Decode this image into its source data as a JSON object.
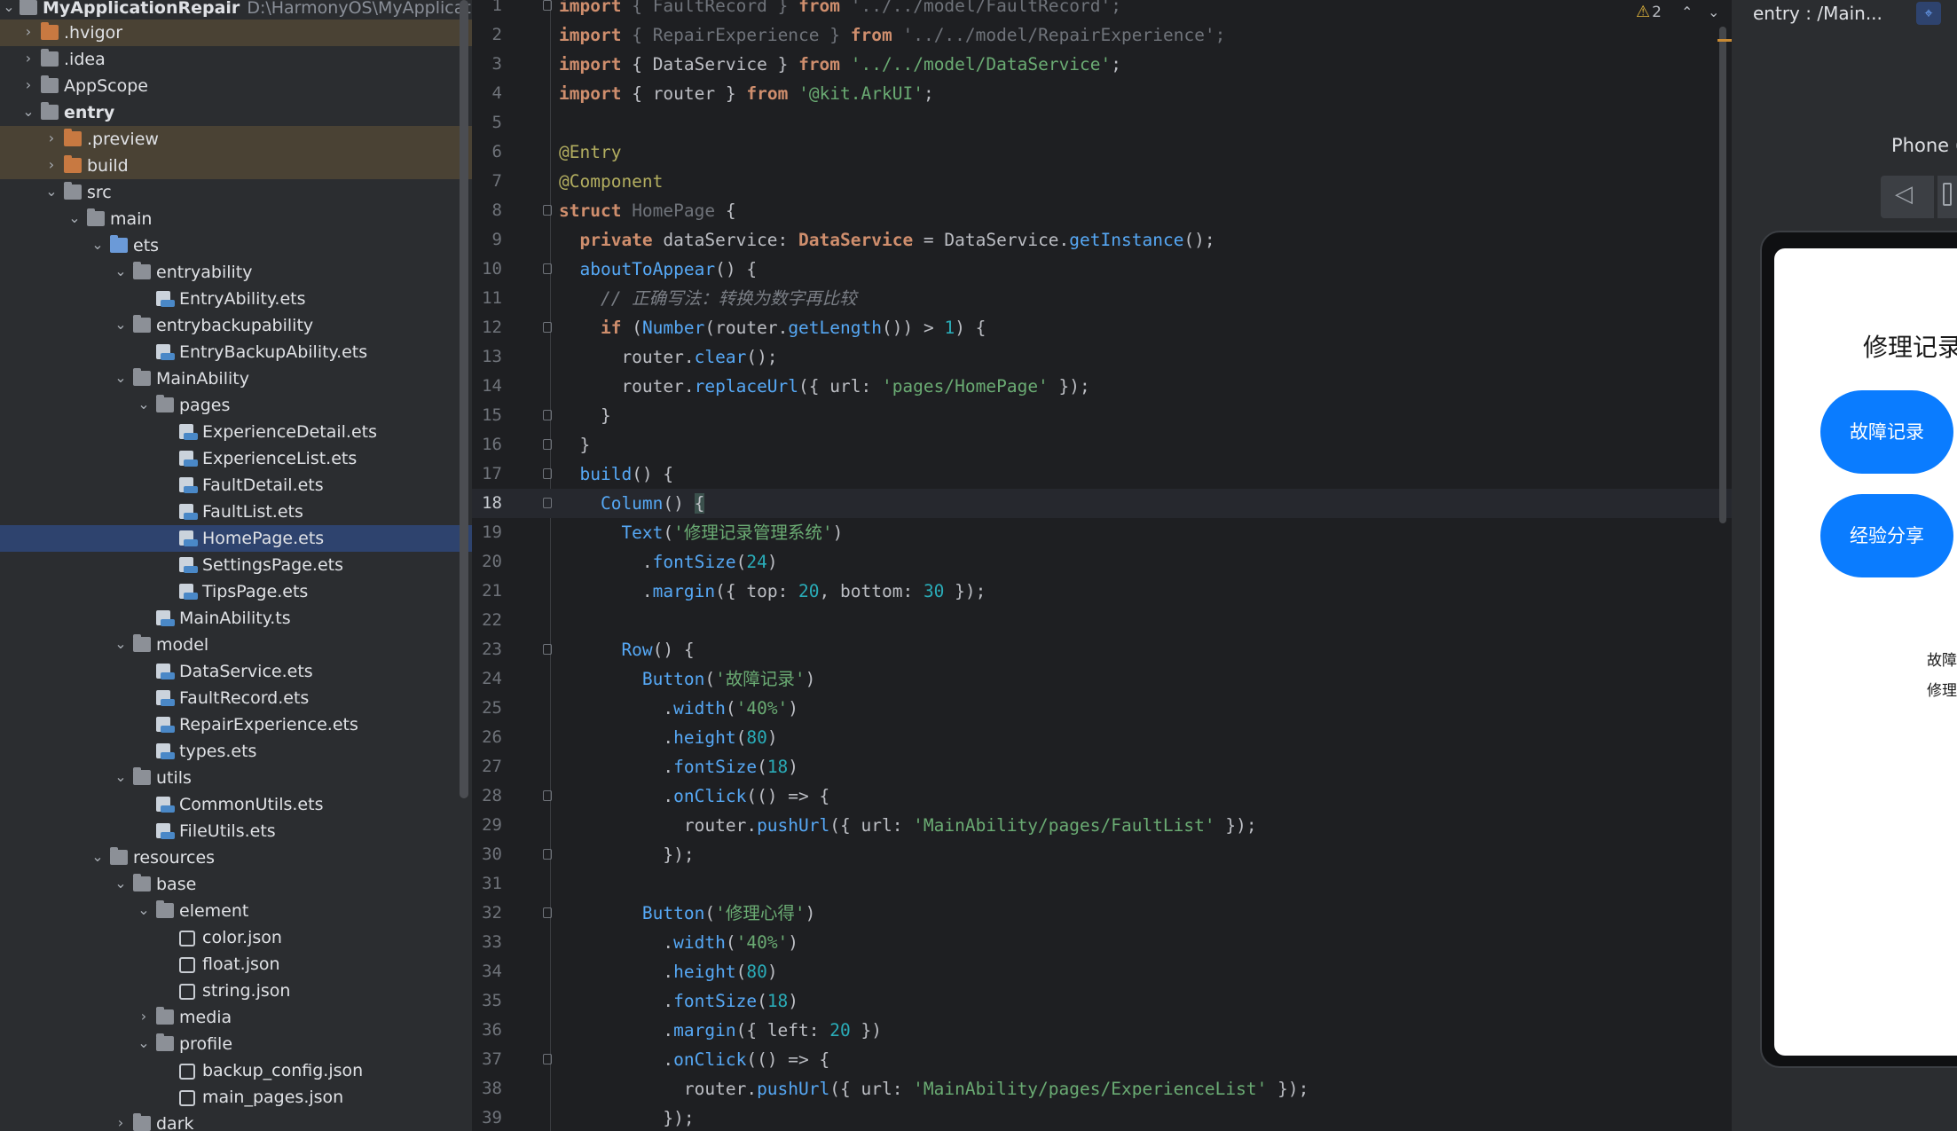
{
  "project": {
    "root": {
      "name": "MyApplicationRepair",
      "path": "D:\\HarmonyOS\\MyApplicationRe"
    },
    "items": [
      {
        "label": ".hvigor",
        "depth": 1,
        "kind": "folder-orange",
        "arrow": "›",
        "state": "excluded"
      },
      {
        "label": ".idea",
        "depth": 1,
        "kind": "folder",
        "arrow": "›",
        "state": ""
      },
      {
        "label": "AppScope",
        "depth": 1,
        "kind": "folder",
        "arrow": "›",
        "state": ""
      },
      {
        "label": "entry",
        "depth": 1,
        "kind": "folder",
        "arrow": "⌄",
        "state": "",
        "bold": true
      },
      {
        "label": ".preview",
        "depth": 2,
        "kind": "folder-orange",
        "arrow": "›",
        "state": "excluded"
      },
      {
        "label": "build",
        "depth": 2,
        "kind": "folder-orange",
        "arrow": "›",
        "state": "excluded"
      },
      {
        "label": "src",
        "depth": 2,
        "kind": "folder",
        "arrow": "⌄",
        "state": ""
      },
      {
        "label": "main",
        "depth": 3,
        "kind": "folder",
        "arrow": "⌄",
        "state": ""
      },
      {
        "label": "ets",
        "depth": 4,
        "kind": "folder-blue",
        "arrow": "⌄",
        "state": ""
      },
      {
        "label": "entryability",
        "depth": 5,
        "kind": "folder",
        "arrow": "⌄",
        "state": ""
      },
      {
        "label": "EntryAbility.ets",
        "depth": 6,
        "kind": "file",
        "arrow": "",
        "state": ""
      },
      {
        "label": "entrybackupability",
        "depth": 5,
        "kind": "folder",
        "arrow": "⌄",
        "state": ""
      },
      {
        "label": "EntryBackupAbility.ets",
        "depth": 6,
        "kind": "file",
        "arrow": "",
        "state": ""
      },
      {
        "label": "MainAbility",
        "depth": 5,
        "kind": "folder",
        "arrow": "⌄",
        "state": ""
      },
      {
        "label": "pages",
        "depth": 6,
        "kind": "folder",
        "arrow": "⌄",
        "state": ""
      },
      {
        "label": "ExperienceDetail.ets",
        "depth": 7,
        "kind": "file",
        "arrow": "",
        "state": ""
      },
      {
        "label": "ExperienceList.ets",
        "depth": 7,
        "kind": "file",
        "arrow": "",
        "state": ""
      },
      {
        "label": "FaultDetail.ets",
        "depth": 7,
        "kind": "file",
        "arrow": "",
        "state": ""
      },
      {
        "label": "FaultList.ets",
        "depth": 7,
        "kind": "file",
        "arrow": "",
        "state": ""
      },
      {
        "label": "HomePage.ets",
        "depth": 7,
        "kind": "file",
        "arrow": "",
        "state": "selected"
      },
      {
        "label": "SettingsPage.ets",
        "depth": 7,
        "kind": "file",
        "arrow": "",
        "state": ""
      },
      {
        "label": "TipsPage.ets",
        "depth": 7,
        "kind": "file",
        "arrow": "",
        "state": ""
      },
      {
        "label": "MainAbility.ts",
        "depth": 6,
        "kind": "file",
        "arrow": "",
        "state": ""
      },
      {
        "label": "model",
        "depth": 5,
        "kind": "folder",
        "arrow": "⌄",
        "state": ""
      },
      {
        "label": "DataService.ets",
        "depth": 6,
        "kind": "file",
        "arrow": "",
        "state": ""
      },
      {
        "label": "FaultRecord.ets",
        "depth": 6,
        "kind": "file",
        "arrow": "",
        "state": ""
      },
      {
        "label": "RepairExperience.ets",
        "depth": 6,
        "kind": "file",
        "arrow": "",
        "state": ""
      },
      {
        "label": "types.ets",
        "depth": 6,
        "kind": "file",
        "arrow": "",
        "state": ""
      },
      {
        "label": "utils",
        "depth": 5,
        "kind": "folder",
        "arrow": "⌄",
        "state": ""
      },
      {
        "label": "CommonUtils.ets",
        "depth": 6,
        "kind": "file",
        "arrow": "",
        "state": ""
      },
      {
        "label": "FileUtils.ets",
        "depth": 6,
        "kind": "file",
        "arrow": "",
        "state": ""
      },
      {
        "label": "resources",
        "depth": 4,
        "kind": "folder",
        "arrow": "⌄",
        "state": ""
      },
      {
        "label": "base",
        "depth": 5,
        "kind": "folder",
        "arrow": "⌄",
        "state": ""
      },
      {
        "label": "element",
        "depth": 6,
        "kind": "folder",
        "arrow": "⌄",
        "state": ""
      },
      {
        "label": "color.json",
        "depth": 7,
        "kind": "json",
        "arrow": "",
        "state": ""
      },
      {
        "label": "float.json",
        "depth": 7,
        "kind": "json",
        "arrow": "",
        "state": ""
      },
      {
        "label": "string.json",
        "depth": 7,
        "kind": "json",
        "arrow": "",
        "state": ""
      },
      {
        "label": "media",
        "depth": 6,
        "kind": "folder",
        "arrow": "›",
        "state": ""
      },
      {
        "label": "profile",
        "depth": 6,
        "kind": "folder",
        "arrow": "⌄",
        "state": ""
      },
      {
        "label": "backup_config.json",
        "depth": 7,
        "kind": "json",
        "arrow": "",
        "state": ""
      },
      {
        "label": "main_pages.json",
        "depth": 7,
        "kind": "json",
        "arrow": "",
        "state": ""
      },
      {
        "label": "dark",
        "depth": 5,
        "kind": "folder",
        "arrow": "›",
        "state": ""
      }
    ]
  },
  "editor": {
    "current_line": 18,
    "warnings": {
      "icon": "⚠",
      "count": "2"
    },
    "nav_up": "⌃",
    "nav_down": "⌄",
    "lines": [
      [
        {
          "t": "import",
          "c": "kw"
        },
        {
          "t": " { ",
          "c": "dim"
        },
        {
          "t": "FaultRecord",
          "c": "dim"
        },
        {
          "t": " } ",
          "c": "dim"
        },
        {
          "t": "from",
          "c": "kw"
        },
        {
          "t": " '../../model/FaultRecord';",
          "c": "dim"
        }
      ],
      [
        {
          "t": "import",
          "c": "kw"
        },
        {
          "t": " { ",
          "c": "dim"
        },
        {
          "t": "RepairExperience",
          "c": "dim"
        },
        {
          "t": " } ",
          "c": "dim"
        },
        {
          "t": "from",
          "c": "kw"
        },
        {
          "t": " '../../model/RepairExperience';",
          "c": "dim"
        }
      ],
      [
        {
          "t": "import",
          "c": "kw"
        },
        {
          "t": " { ",
          "c": ""
        },
        {
          "t": "DataService",
          "c": ""
        },
        {
          "t": " } ",
          "c": ""
        },
        {
          "t": "from",
          "c": "kw"
        },
        {
          "t": " '../../model/DataService'",
          "c": "str"
        },
        {
          "t": ";",
          "c": ""
        }
      ],
      [
        {
          "t": "import",
          "c": "kw"
        },
        {
          "t": " { ",
          "c": ""
        },
        {
          "t": "router",
          "c": ""
        },
        {
          "t": " } ",
          "c": ""
        },
        {
          "t": "from",
          "c": "kw"
        },
        {
          "t": " '@kit.ArkUI'",
          "c": "str"
        },
        {
          "t": ";",
          "c": ""
        }
      ],
      [],
      [
        {
          "t": "@Entry",
          "c": "ann"
        }
      ],
      [
        {
          "t": "@Component",
          "c": "ann"
        }
      ],
      [
        {
          "t": "struct",
          "c": "kw"
        },
        {
          "t": " HomePage ",
          "c": "dim"
        },
        {
          "t": "{",
          "c": ""
        }
      ],
      [
        {
          "t": "  private",
          "c": "kw"
        },
        {
          "t": " dataService: ",
          "c": ""
        },
        {
          "t": "DataService",
          "c": "kw"
        },
        {
          "t": " = DataService.",
          "c": ""
        },
        {
          "t": "getInstance",
          "c": "fn"
        },
        {
          "t": "();",
          "c": ""
        }
      ],
      [
        {
          "t": "  aboutToAppear",
          "c": "fn"
        },
        {
          "t": "() {",
          "c": ""
        }
      ],
      [
        {
          "t": "    // 正确写法：转换为数字再比较",
          "c": "cmt"
        }
      ],
      [
        {
          "t": "    if",
          "c": "kw"
        },
        {
          "t": " (",
          "c": ""
        },
        {
          "t": "Number",
          "c": "fn"
        },
        {
          "t": "(router.",
          "c": ""
        },
        {
          "t": "getLength",
          "c": "fn"
        },
        {
          "t": "()) > ",
          "c": ""
        },
        {
          "t": "1",
          "c": "num"
        },
        {
          "t": ") {",
          "c": ""
        }
      ],
      [
        {
          "t": "      router.",
          "c": ""
        },
        {
          "t": "clear",
          "c": "fn"
        },
        {
          "t": "();",
          "c": ""
        }
      ],
      [
        {
          "t": "      router.",
          "c": ""
        },
        {
          "t": "replaceUrl",
          "c": "fn"
        },
        {
          "t": "({ url: ",
          "c": ""
        },
        {
          "t": "'pages/HomePage'",
          "c": "str"
        },
        {
          "t": " });",
          "c": ""
        }
      ],
      [
        {
          "t": "    }",
          "c": ""
        }
      ],
      [
        {
          "t": "  }",
          "c": ""
        }
      ],
      [
        {
          "t": "  build",
          "c": "fn"
        },
        {
          "t": "() {",
          "c": ""
        }
      ],
      [
        {
          "t": "    Column",
          "c": "fn"
        },
        {
          "t": "() ",
          "c": ""
        },
        {
          "t": "{",
          "c": "brk"
        }
      ],
      [
        {
          "t": "      Text",
          "c": "fn"
        },
        {
          "t": "(",
          "c": ""
        },
        {
          "t": "'修理记录管理系统'",
          "c": "str"
        },
        {
          "t": ")",
          "c": ""
        }
      ],
      [
        {
          "t": "        .",
          "c": ""
        },
        {
          "t": "fontSize",
          "c": "fn"
        },
        {
          "t": "(",
          "c": ""
        },
        {
          "t": "24",
          "c": "num"
        },
        {
          "t": ")",
          "c": ""
        }
      ],
      [
        {
          "t": "        .",
          "c": ""
        },
        {
          "t": "margin",
          "c": "fn"
        },
        {
          "t": "({ top: ",
          "c": ""
        },
        {
          "t": "20",
          "c": "num"
        },
        {
          "t": ", bottom: ",
          "c": ""
        },
        {
          "t": "30",
          "c": "num"
        },
        {
          "t": " });",
          "c": ""
        }
      ],
      [],
      [
        {
          "t": "      Row",
          "c": "fn"
        },
        {
          "t": "() {",
          "c": ""
        }
      ],
      [
        {
          "t": "        Button",
          "c": "fn"
        },
        {
          "t": "(",
          "c": ""
        },
        {
          "t": "'故障记录'",
          "c": "str"
        },
        {
          "t": ")",
          "c": ""
        }
      ],
      [
        {
          "t": "          .",
          "c": ""
        },
        {
          "t": "width",
          "c": "fn"
        },
        {
          "t": "(",
          "c": ""
        },
        {
          "t": "'40%'",
          "c": "str"
        },
        {
          "t": ")",
          "c": ""
        }
      ],
      [
        {
          "t": "          .",
          "c": ""
        },
        {
          "t": "height",
          "c": "fn"
        },
        {
          "t": "(",
          "c": ""
        },
        {
          "t": "80",
          "c": "num"
        },
        {
          "t": ")",
          "c": ""
        }
      ],
      [
        {
          "t": "          .",
          "c": ""
        },
        {
          "t": "fontSize",
          "c": "fn"
        },
        {
          "t": "(",
          "c": ""
        },
        {
          "t": "18",
          "c": "num"
        },
        {
          "t": ")",
          "c": ""
        }
      ],
      [
        {
          "t": "          .",
          "c": ""
        },
        {
          "t": "onClick",
          "c": "fn"
        },
        {
          "t": "(() => {",
          "c": ""
        }
      ],
      [
        {
          "t": "            router.",
          "c": ""
        },
        {
          "t": "pushUrl",
          "c": "fn"
        },
        {
          "t": "({ url: ",
          "c": ""
        },
        {
          "t": "'MainAbility/pages/FaultList'",
          "c": "str"
        },
        {
          "t": " });",
          "c": ""
        }
      ],
      [
        {
          "t": "          });",
          "c": ""
        }
      ],
      [],
      [
        {
          "t": "        Button",
          "c": "fn"
        },
        {
          "t": "(",
          "c": ""
        },
        {
          "t": "'修理心得'",
          "c": "str"
        },
        {
          "t": ")",
          "c": ""
        }
      ],
      [
        {
          "t": "          .",
          "c": ""
        },
        {
          "t": "width",
          "c": "fn"
        },
        {
          "t": "(",
          "c": ""
        },
        {
          "t": "'40%'",
          "c": "str"
        },
        {
          "t": ")",
          "c": ""
        }
      ],
      [
        {
          "t": "          .",
          "c": ""
        },
        {
          "t": "height",
          "c": "fn"
        },
        {
          "t": "(",
          "c": ""
        },
        {
          "t": "80",
          "c": "num"
        },
        {
          "t": ")",
          "c": ""
        }
      ],
      [
        {
          "t": "          .",
          "c": ""
        },
        {
          "t": "fontSize",
          "c": "fn"
        },
        {
          "t": "(",
          "c": ""
        },
        {
          "t": "18",
          "c": "num"
        },
        {
          "t": ")",
          "c": ""
        }
      ],
      [
        {
          "t": "          .",
          "c": ""
        },
        {
          "t": "margin",
          "c": "fn"
        },
        {
          "t": "({ left: ",
          "c": ""
        },
        {
          "t": "20",
          "c": "num"
        },
        {
          "t": " })",
          "c": ""
        }
      ],
      [
        {
          "t": "          .",
          "c": ""
        },
        {
          "t": "onClick",
          "c": "fn"
        },
        {
          "t": "(() => {",
          "c": ""
        }
      ],
      [
        {
          "t": "            router.",
          "c": ""
        },
        {
          "t": "pushUrl",
          "c": "fn"
        },
        {
          "t": "({ url: ",
          "c": ""
        },
        {
          "t": "'MainAbility/pages/ExperienceList'",
          "c": "str"
        },
        {
          "t": " });",
          "c": ""
        }
      ],
      [
        {
          "t": "          });",
          "c": ""
        }
      ]
    ]
  },
  "previewer": {
    "title": "entry : /Main...",
    "device": "Phone (",
    "back_icon": "◁",
    "app": {
      "title": "修理记录",
      "button_fault": "故障记录",
      "button_experience": "经验分享",
      "text_1": "故障记",
      "text_2": "修理心"
    }
  },
  "colors": {
    "accent": "#0a7cff",
    "selection": "#2e436e",
    "excluded": "#4a4234"
  }
}
